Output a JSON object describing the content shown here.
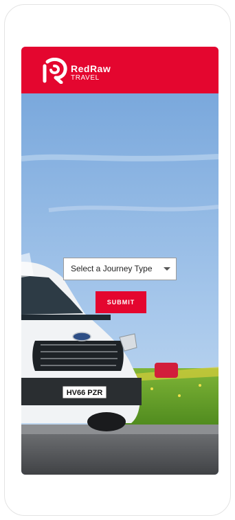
{
  "header": {
    "brand_name": "RedRaw",
    "brand_sub": "TRAVEL",
    "logo_icon": "redraw-logo-icon"
  },
  "hero": {
    "image": "van-on-road-photo",
    "license_plate": "HV66 PZR"
  },
  "form": {
    "journey_select": {
      "value": "Select a Journey Type",
      "icon": "chevron-down-icon"
    },
    "submit_label": "SUBMIT"
  },
  "colors": {
    "brand_red": "#e4062f",
    "sky_blue": "#8fb6e2"
  }
}
